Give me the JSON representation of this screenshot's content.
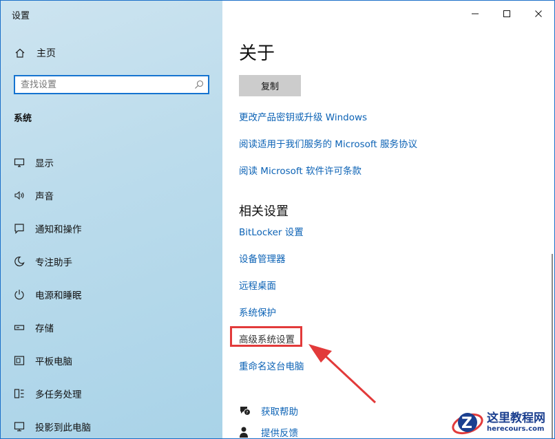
{
  "window": {
    "title": "设置"
  },
  "sidebar": {
    "home_label": "主页",
    "search_placeholder": "查找设置",
    "section_title": "系统",
    "items": [
      {
        "label": "显示",
        "icon": "monitor-icon"
      },
      {
        "label": "声音",
        "icon": "speaker-icon"
      },
      {
        "label": "通知和操作",
        "icon": "notification-icon"
      },
      {
        "label": "专注助手",
        "icon": "moon-icon"
      },
      {
        "label": "电源和睡眠",
        "icon": "power-icon"
      },
      {
        "label": "存储",
        "icon": "storage-icon"
      },
      {
        "label": "平板电脑",
        "icon": "tablet-icon"
      },
      {
        "label": "多任务处理",
        "icon": "multitask-icon"
      },
      {
        "label": "投影到此电脑",
        "icon": "project-icon"
      }
    ]
  },
  "main": {
    "title": "关于",
    "copy_button": "复制",
    "links": [
      "更改产品密钥或升级 Windows",
      "阅读适用于我们服务的 Microsoft 服务协议",
      "阅读 Microsoft 软件许可条款"
    ],
    "related_title": "相关设置",
    "related_links": [
      "BitLocker 设置",
      "设备管理器",
      "远程桌面",
      "系统保护",
      "高级系统设置",
      "重命名这台电脑"
    ],
    "help_links": [
      {
        "label": "获取帮助",
        "icon": "help-chat-icon"
      },
      {
        "label": "提供反馈",
        "icon": "feedback-icon"
      }
    ]
  },
  "watermark": {
    "cn": "这里教程网",
    "en": "herecours.com",
    "logo_letter": "Z"
  },
  "colors": {
    "accent": "#0b62b5",
    "highlight": "#e23a3a",
    "watermark": "#1b3f8f"
  }
}
